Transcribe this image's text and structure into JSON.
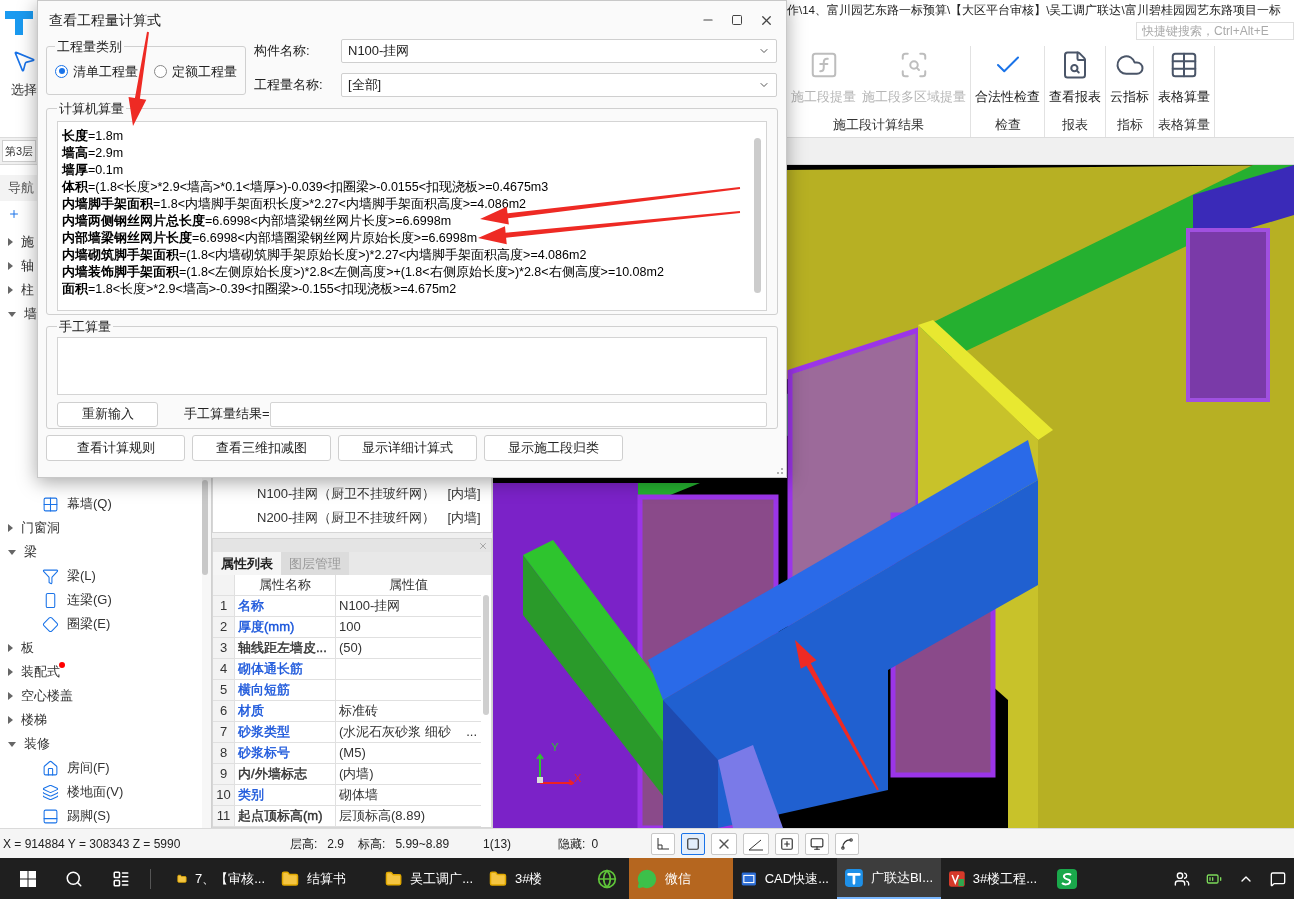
{
  "app": {
    "path_title": "作\\14、富川园艺东路一标预算\\【大区平台审核】\\吴工调广联达\\富川碧桂园园艺东路项目一标",
    "search": {
      "placeholder": "快捷键搜索，Ctrl+Alt+E"
    },
    "select_tool": "选择"
  },
  "ribbon": {
    "groups": [
      {
        "label": "施工段计算结果",
        "buttons": [
          {
            "label": "施工段提量",
            "disabled": true
          },
          {
            "label": "施工段多区域提量",
            "disabled": true
          }
        ]
      },
      {
        "label": "检查",
        "buttons": [
          {
            "label": "合法性检查",
            "disabled": false
          }
        ]
      },
      {
        "label": "报表",
        "buttons": [
          {
            "label": "查看报表",
            "disabled": false
          }
        ]
      },
      {
        "label": "指标",
        "buttons": [
          {
            "label": "云指标",
            "disabled": false
          }
        ]
      },
      {
        "label": "表格算量",
        "buttons": [
          {
            "label": "表格算量",
            "disabled": false
          }
        ]
      }
    ]
  },
  "floor_selector": "第3层",
  "nav": {
    "title": "导航",
    "tree": [
      {
        "label": "施",
        "expanded": false,
        "dot": false
      },
      {
        "label": "轴",
        "expanded": false,
        "dot": false
      },
      {
        "label": "柱",
        "expanded": false,
        "dot": false
      },
      {
        "label": "墙",
        "expanded": true,
        "dot": false,
        "children": [
          {
            "label": "幕墙(Q)"
          }
        ]
      },
      {
        "label": "门窗洞",
        "expanded": false,
        "dot": false
      },
      {
        "label": "梁",
        "expanded": true,
        "dot": false,
        "children": [
          {
            "label": "梁(L)"
          },
          {
            "label": "连梁(G)"
          },
          {
            "label": "圈梁(E)"
          }
        ]
      },
      {
        "label": "板",
        "expanded": false,
        "dot": false
      },
      {
        "label": "装配式",
        "expanded": false,
        "dot": true
      },
      {
        "label": "空心楼盖",
        "expanded": false,
        "dot": false
      },
      {
        "label": "楼梯",
        "expanded": false,
        "dot": false
      },
      {
        "label": "装修",
        "expanded": true,
        "dot": false,
        "children": [
          {
            "label": "房间(F)"
          },
          {
            "label": "楼地面(V)"
          },
          {
            "label": "踢脚(S)"
          }
        ]
      }
    ]
  },
  "components": [
    {
      "name": "N100-挂网（厨卫不挂玻纤网）",
      "type": "[内墙]"
    },
    {
      "name": "N200-挂网（厨卫不挂玻纤网）",
      "type": "[内墙]"
    }
  ],
  "properties": {
    "tabs": [
      {
        "label": "属性列表",
        "selected": true
      },
      {
        "label": "图层管理",
        "selected": false
      }
    ],
    "columns": [
      "属性名称",
      "属性值"
    ],
    "rows": [
      {
        "index": "1",
        "name": "名称",
        "value": "N100-挂网",
        "color": "#1a56db"
      },
      {
        "index": "2",
        "name": "厚度(mm)",
        "value": "100",
        "color": "#1a56db"
      },
      {
        "index": "3",
        "name": "轴线距左墙皮...",
        "value": "(50)",
        "color": "#333333"
      },
      {
        "index": "4",
        "name": "砌体通长筋",
        "value": "",
        "color": "#1a56db"
      },
      {
        "index": "5",
        "name": "横向短筋",
        "value": "",
        "color": "#1a56db"
      },
      {
        "index": "6",
        "name": "材质",
        "value": "标准砖",
        "color": "#1a56db"
      },
      {
        "index": "7",
        "name": "砂浆类型",
        "value": "(水泥石灰砂浆 细砂",
        "more": "...",
        "color": "#1a56db"
      },
      {
        "index": "8",
        "name": "砂浆标号",
        "value": "(M5)",
        "color": "#1a56db"
      },
      {
        "index": "9",
        "name": "内/外墙标志",
        "value": "(内墙)",
        "color": "#333333"
      },
      {
        "index": "10",
        "name": "类别",
        "value": "砌体墙",
        "color": "#1a56db"
      },
      {
        "index": "11",
        "name": "起点顶标高(m)",
        "value": "层顶标高(8.89)",
        "color": "#333333"
      }
    ]
  },
  "viewport": {
    "axis_labels": {
      "y": "Y",
      "x": "X"
    }
  },
  "status_bar": {
    "coords": "X = 914884 Y = 308343 Z = 5990",
    "fields": [
      {
        "label": "层高:",
        "value": "2.9"
      },
      {
        "label": "标高:",
        "value": "5.99~8.89"
      }
    ],
    "count": "1(13)",
    "hidden": {
      "label": "隐藏:",
      "value": "0"
    },
    "tools": [
      {
        "kind": "corner",
        "selected": false
      },
      {
        "kind": "rect",
        "selected": true
      },
      {
        "kind": "cross",
        "selected": false
      },
      {
        "kind": "angle",
        "selected": false
      },
      {
        "kind": "insert",
        "selected": false
      },
      {
        "kind": "screen",
        "selected": false
      },
      {
        "kind": "curve",
        "selected": false
      }
    ]
  },
  "taskbar": {
    "items": [
      {
        "label": "7、【审核...",
        "kind": "folder",
        "selected": false,
        "flashing": false
      },
      {
        "label": "结算书",
        "kind": "folder",
        "selected": false,
        "flashing": false
      },
      {
        "label": "吴工调广...",
        "kind": "folder",
        "selected": false,
        "flashing": false
      },
      {
        "label": "3#楼",
        "kind": "folder",
        "selected": false,
        "flashing": false
      },
      {
        "kind": "browser",
        "selected": false,
        "flashing": false
      },
      {
        "label": "微信",
        "kind": "chat",
        "selected": false,
        "flashing": true
      },
      {
        "label": "CAD快速...",
        "kind": "cad",
        "selected": false,
        "flashing": false
      },
      {
        "label": "广联达BI...",
        "kind": "logo",
        "selected": true,
        "flashing": false
      },
      {
        "label": "3#楼工程...",
        "kind": "sheet",
        "selected": false,
        "flashing": false
      },
      {
        "kind": "s",
        "selected": false,
        "flashing": false
      }
    ]
  },
  "dialog": {
    "title": "查看工程量计算式",
    "category": {
      "title": "工程量类别",
      "options": [
        {
          "label": "清单工程量",
          "selected": true
        },
        {
          "label": "定额工程量",
          "selected": false
        }
      ]
    },
    "component_name": {
      "label": "构件名称:",
      "value": "N100-挂网"
    },
    "quantity_name": {
      "label": "工程量名称:",
      "value": "[全部]"
    },
    "computer": {
      "title": "计算机算量",
      "lines": [
        "**长度**=1.8m",
        "**墙高**=2.9m",
        "**墙厚**=0.1m",
        "**体积**=(1.8<长度>*2.9<墙高>*0.1<墙厚>)-0.039<扣圈梁>-0.0155<扣现浇板>=0.4675m3",
        "**内墙脚手架面积**=1.8<内墙脚手架面积长度>*2.27<内墙脚手架面积高度>=4.086m2",
        "**内墙两侧钢丝网片总长度**=6.6998<内部墙梁钢丝网片长度>=6.6998m",
        "**内部墙梁钢丝网片长度**=6.6998<内部墙圈梁钢丝网片原始长度>=6.6998m",
        "**内墙砌筑脚手架面积**=(1.8<内墙砌筑脚手架原始长度>)*2.27<内墙脚手架面积高度>=4.086m2",
        "**内墙装饰脚手架面积**=(1.8<左侧原始长度>)*2.8<左侧高度>+(1.8<右侧原始长度>)*2.8<右侧高度>=10.08m2",
        "**面积**=1.8<长度>*2.9<墙高>-0.39<扣圈梁>-0.155<扣现浇板>=4.675m2"
      ]
    },
    "manual": {
      "title": "手工算量",
      "reset_button": "重新输入",
      "result_label": "手工算量结果="
    },
    "buttons": [
      "查看计算规则",
      "查看三维扣减图",
      "显示详细计算式",
      "显示施工段归类"
    ]
  }
}
